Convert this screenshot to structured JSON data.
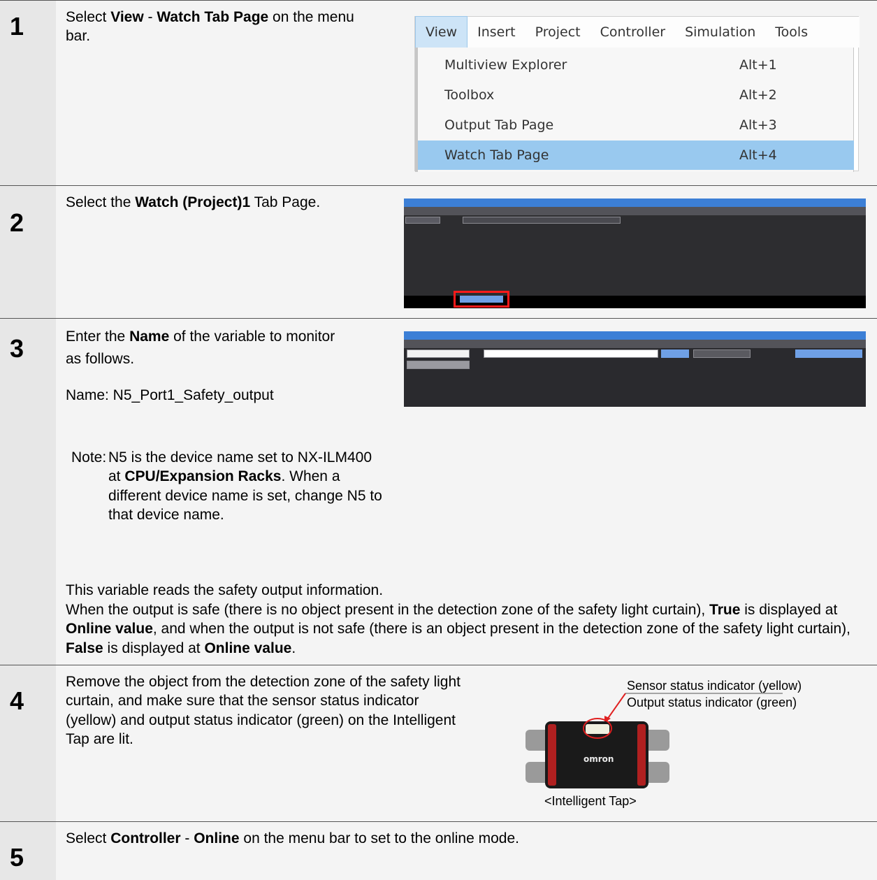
{
  "steps": [
    {
      "number": "1",
      "text": {
        "pre": "Select ",
        "b1": "View",
        "mid": " - ",
        "b2": "Watch Tab Page",
        "post": " on the menu bar."
      },
      "menu": {
        "bar": [
          "View",
          "Insert",
          "Project",
          "Controller",
          "Simulation",
          "Tools"
        ],
        "items": [
          {
            "label": "Multiview Explorer",
            "shortcut": "Alt+1"
          },
          {
            "label": "Toolbox",
            "shortcut": "Alt+2"
          },
          {
            "label": "Output Tab Page",
            "shortcut": "Alt+3"
          },
          {
            "label": "Watch Tab Page",
            "shortcut": "Alt+4"
          }
        ]
      }
    },
    {
      "number": "2",
      "text": {
        "pre": "Select the ",
        "b1": "Watch (Project)1",
        "post": " Tab Page."
      }
    },
    {
      "number": "3",
      "text": {
        "pre": "Enter the ",
        "b1": "Name",
        "post": " of the variable to monitor as follows.",
        "name_line": "Name: N5_Port1_Safety_output"
      },
      "note": {
        "label": "Note:",
        "p1": "N5 is the device name set to NX-ILM400 at ",
        "b1": "CPU/Expansion Racks",
        "p2": ". When a different device name is set, change N5 to that device name."
      },
      "explanation": {
        "line1": "This variable reads the safety output information.",
        "s1": "When the output is safe (there is no object present in the detection zone of the safety light curtain), ",
        "b1": "True",
        "s2": " is displayed at ",
        "b2": "Online value",
        "s3": ", and when the output is not safe (there is an object present in the detection zone of the safety light curtain), ",
        "b3": "False",
        "s4": " is displayed at ",
        "b4": "Online value",
        "s5": "."
      }
    },
    {
      "number": "4",
      "text": "Remove the object from the detection zone of the safety light curtain, and make sure that the sensor status indicator (yellow) and output status indicator (green) on the Intelligent Tap are lit.",
      "callout1": "Sensor status indicator (yellow)",
      "callout2": "Output status indicator (green)",
      "caption": "<Intelligent Tap>",
      "logo": "omron"
    },
    {
      "number": "5",
      "text": {
        "pre": "Select ",
        "b1": "Controller",
        "mid": " - ",
        "b2": "Online",
        "post": " on the menu bar to set to the online mode."
      }
    }
  ]
}
